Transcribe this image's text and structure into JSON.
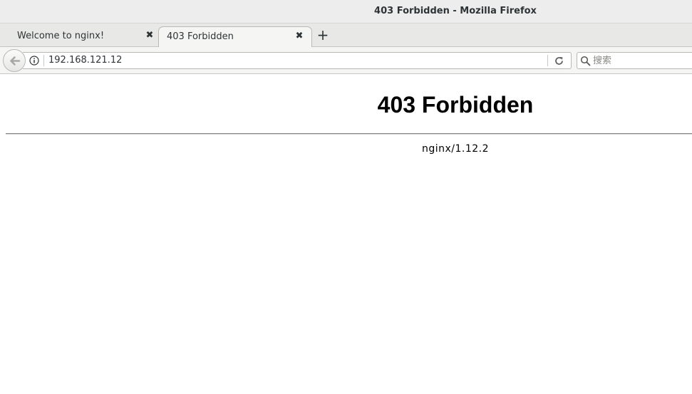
{
  "window": {
    "title": "403 Forbidden - Mozilla Firefox"
  },
  "tabs": [
    {
      "label": "Welcome to nginx!",
      "active": false
    },
    {
      "label": "403 Forbidden",
      "active": true
    }
  ],
  "toolbar": {
    "close_glyph": "✖",
    "new_tab_glyph": "+",
    "url": "192.168.121.12",
    "search_placeholder": "搜索"
  },
  "page": {
    "heading": "403 Forbidden",
    "server_signature": "nginx/1.12.2"
  }
}
